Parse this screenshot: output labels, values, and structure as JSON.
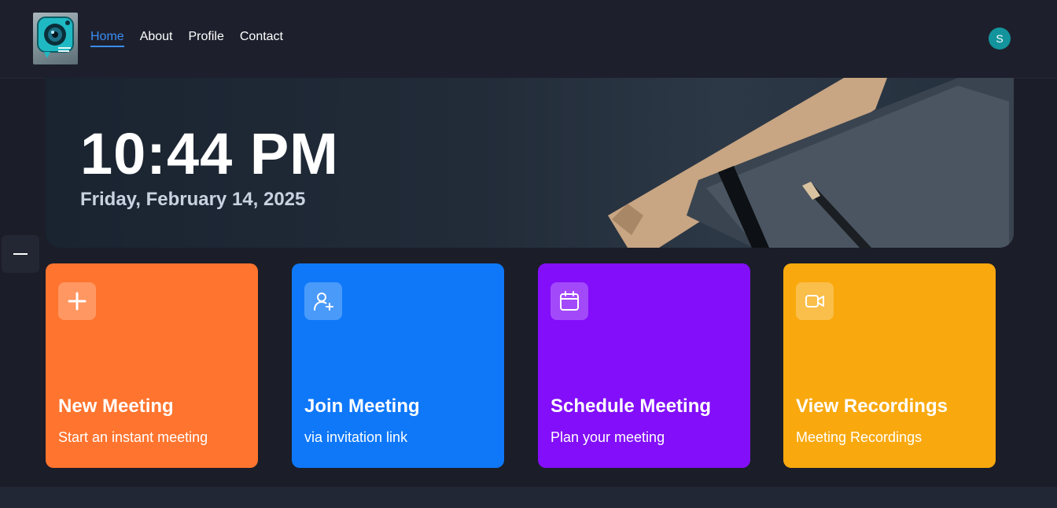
{
  "nav": {
    "links": [
      {
        "label": "Home",
        "active": true
      },
      {
        "label": "About",
        "active": false
      },
      {
        "label": "Profile",
        "active": false
      },
      {
        "label": "Contact",
        "active": false
      }
    ],
    "avatar_initial": "S",
    "logo_icon": "camera-chat-icon"
  },
  "hero": {
    "time": "10:44 PM",
    "date": "Friday, February 14, 2025"
  },
  "sidebar_toggle_icon": "minus-icon",
  "cards": [
    {
      "title": "New Meeting",
      "subtitle": "Start an instant meeting",
      "icon": "plus-icon",
      "color": "#ff742e"
    },
    {
      "title": "Join Meeting",
      "subtitle": "via invitation link",
      "icon": "user-plus-icon",
      "color": "#0e78f9"
    },
    {
      "title": "Schedule Meeting",
      "subtitle": "Plan your meeting",
      "icon": "calendar-icon",
      "color": "#830ef9"
    },
    {
      "title": "View Recordings",
      "subtitle": "Meeting Recordings",
      "icon": "video-icon",
      "color": "#f9a90e"
    }
  ]
}
